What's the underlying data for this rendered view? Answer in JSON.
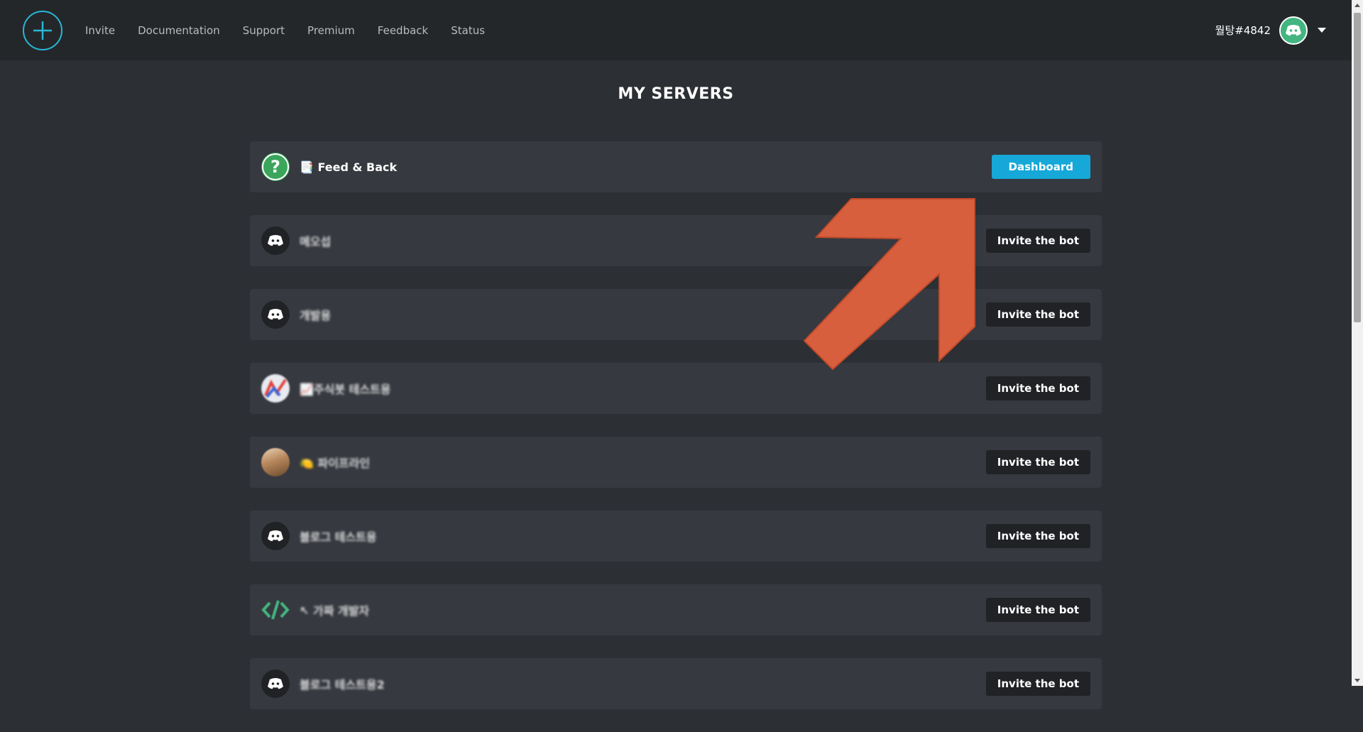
{
  "nav": {
    "links": [
      "Invite",
      "Documentation",
      "Support",
      "Premium",
      "Feedback",
      "Status"
    ],
    "username": "뭘탕#4842"
  },
  "page": {
    "title": "MY SERVERS"
  },
  "servers": [
    {
      "name": "📑 Feed & Back",
      "button": "Dashboard",
      "icon": "question-icon"
    },
    {
      "name": "메오섭",
      "button": "Invite the bot",
      "icon": "discord-icon"
    },
    {
      "name": "개발용",
      "button": "Invite the bot",
      "icon": "discord-icon"
    },
    {
      "name": "📈주식봇 테스트용",
      "button": "Invite the bot",
      "icon": "chart-icon"
    },
    {
      "name": "🍋 파이프라인",
      "button": "Invite the bot",
      "icon": "image-icon"
    },
    {
      "name": "블로그 테스트용",
      "button": "Invite the bot",
      "icon": "discord-icon"
    },
    {
      "name": "↖ 가짜 개발자",
      "button": "Invite the bot",
      "icon": "code-icon"
    },
    {
      "name": "블로그 테스트용2",
      "button": "Invite the bot",
      "icon": "discord-icon"
    }
  ],
  "colors": {
    "accent": "#16a8d8",
    "background": "#2c2f33",
    "row": "#36393f",
    "arrow": "#d75f3e"
  }
}
